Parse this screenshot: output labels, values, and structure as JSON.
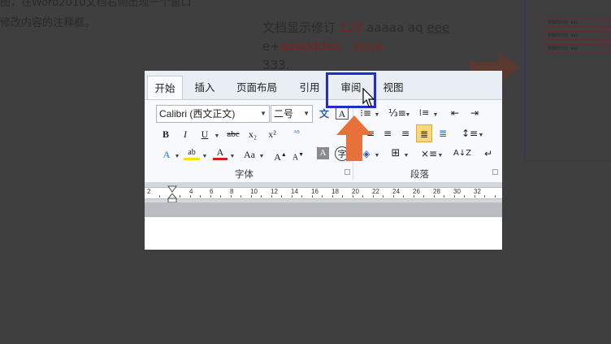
{
  "background": {
    "line1": "图，在Word2010文档右侧出现一个窗口",
    "line2": "修改内容的注释框。",
    "demo": {
      "line1_prefix": "文档显示修订 ",
      "line1_inserted": "123",
      "line1_rest": " aaaaa aq  ",
      "line1_underlined": "eee",
      "line2_prefix": "e+",
      "line2_inserted": "aaadddaa",
      "line2_deleted": "aaaa",
      "line3": "333."
    },
    "comment_cards": [
      "删除的内容: aaa",
      "删除的内容: aaa",
      "删除的内容: aaa"
    ]
  },
  "tabs": [
    {
      "label": "开始"
    },
    {
      "label": "插入"
    },
    {
      "label": "页面布局"
    },
    {
      "label": "引用"
    },
    {
      "label": "审阅"
    },
    {
      "label": "视图"
    }
  ],
  "font_group": {
    "font_name": "Calibri (西文正文)",
    "font_size": "二号",
    "label": "字体"
  },
  "paragraph_group": {
    "label": "段落"
  },
  "ruler_numbers": [
    "2",
    "2",
    "4",
    "6",
    "8",
    "10",
    "12",
    "14",
    "16",
    "18",
    "20",
    "22",
    "24",
    "26",
    "28",
    "30",
    "32"
  ],
  "colors": {
    "accent_highlight": "#1f2bd6",
    "arrow": "#e8703a",
    "font_color_bar": "#d11f1f",
    "highlight_bar": "#f2e600"
  }
}
